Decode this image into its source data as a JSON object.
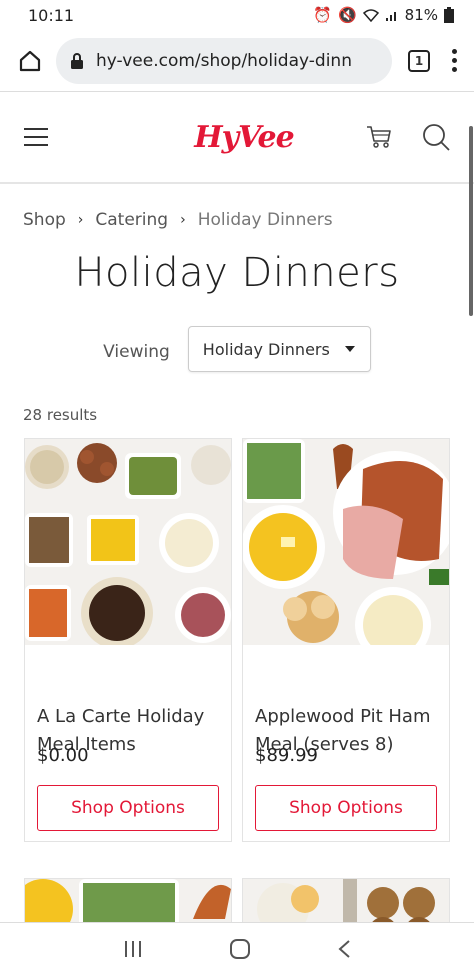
{
  "status": {
    "time": "10:11",
    "battery": "81%"
  },
  "browser": {
    "url": "hy-vee.com/shop/holiday-dinn",
    "tab_count": "1"
  },
  "header": {
    "logo": "HyVee"
  },
  "breadcrumb": {
    "items": [
      "Shop",
      "Catering",
      "Holiday Dinners"
    ]
  },
  "page": {
    "title": "Holiday Dinners",
    "viewing_label": "Viewing",
    "viewing_selected": "Holiday Dinners",
    "results": "28 results"
  },
  "products": [
    {
      "name": "A La Carte Holiday Meal Items",
      "price": "$0.00",
      "button": "Shop Options"
    },
    {
      "name": "Applewood Pit Ham Meal (serves 8)",
      "price": "$89.99",
      "button": "Shop Options"
    }
  ],
  "colors": {
    "brand_red": "#e31837"
  }
}
